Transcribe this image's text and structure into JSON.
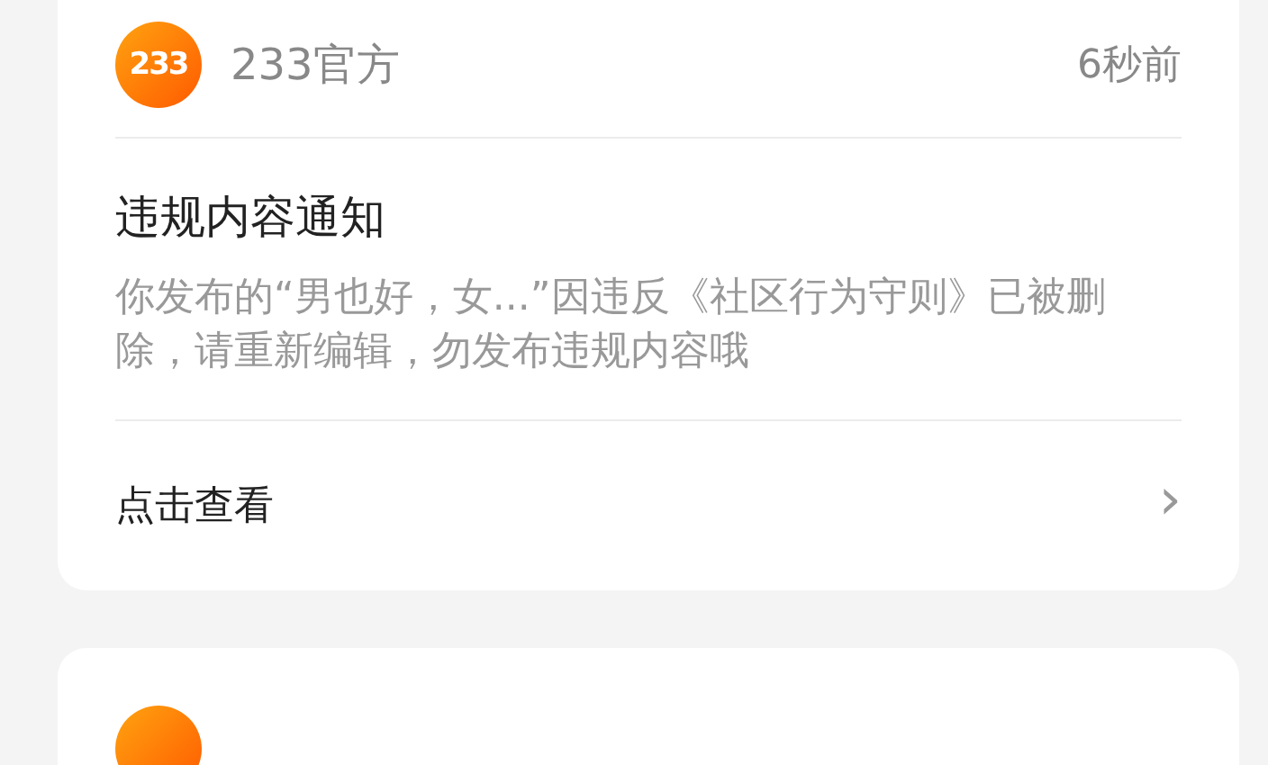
{
  "notification": {
    "logo_text": "233",
    "sender": "233官方",
    "time": "6秒前",
    "title": "违规内容通知",
    "body": "你发布的“男也好，女...”因违反《社区行为守则》已被删除，请重新编辑，勿发布违规内容哦",
    "action": "点击查看",
    "chevron": "›"
  }
}
